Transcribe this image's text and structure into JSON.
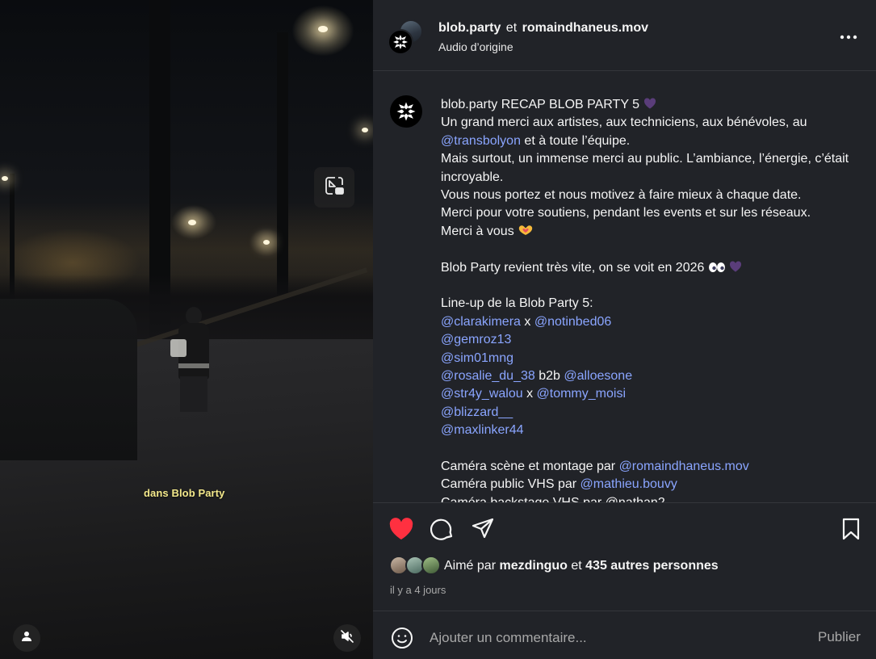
{
  "video": {
    "caption": "dans Blob Party"
  },
  "header": {
    "user1": "blob.party",
    "joiner": "et",
    "user2": "romaindhaneus.mov",
    "audio": "Audio d’origine"
  },
  "post": {
    "author": "blob.party",
    "title": "RECAP BLOB PARTY 5",
    "line1": "Un grand merci aux artistes, aux techniciens, aux bénévoles, au",
    "mention_transbolyon": "@transbolyon",
    "line1b": " et à toute l’équipe.",
    "line2": "Mais surtout, un immense merci au public. L’ambiance, l’énergie, c’était incroyable.",
    "line3": "Vous nous portez et nous motivez à faire mieux à chaque date.",
    "line4": "Merci pour votre soutiens, pendant les events et sur les réseaux.",
    "line5": "Merci à vous",
    "line6": "Blob Party revient très vite, on se voit en 2026",
    "lineup_title": "Line-up de la Blob Party 5:",
    "lineup": [
      {
        "a": "@clarakimera",
        "sep": " x ",
        "b": "@notinbed06"
      },
      {
        "a": "@gemroz13"
      },
      {
        "a": "@sim01mng"
      },
      {
        "a": "@rosalie_du_38",
        "sep": " b2b ",
        "b": "@alloesone"
      },
      {
        "a": "@str4y_walou",
        "sep": " x ",
        "b": "@tommy_moisi"
      },
      {
        "a": "@blizzard__"
      },
      {
        "a": "@maxlinker44"
      }
    ],
    "credit1_label": "Caméra scène et montage par ",
    "credit1_user": "@romaindhaneus.mov",
    "credit2_label": "Caméra public VHS par ",
    "credit2_user": "@mathieu.bouvy",
    "credit3_partial": "Caméra backstage VHS par @nathan2..."
  },
  "likes": {
    "prefix": "Aimé par ",
    "user": "mezdinguo",
    "joiner": " et ",
    "others": "435 autres personnes"
  },
  "timestamp": "il y a 4 jours",
  "comment": {
    "placeholder": "Ajouter un commentaire...",
    "publish": "Publier"
  },
  "colors": {
    "panel_bg": "#212328",
    "mention": "#8aa5ff",
    "like_red": "#ff3040",
    "caption_yellow": "#f3e88a"
  },
  "icons": [
    "picture-in-picture-icon",
    "user-tag-icon",
    "muted-speaker-icon",
    "more-icon",
    "heart-icon",
    "comment-icon",
    "share-icon",
    "bookmark-icon",
    "emoji-icon",
    "purple-heart-emoji",
    "heart-hands-emoji",
    "eyes-emoji"
  ]
}
